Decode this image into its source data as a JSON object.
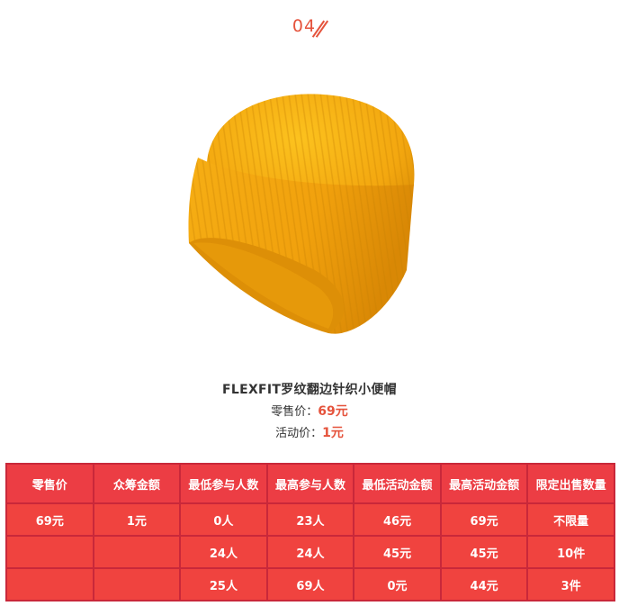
{
  "section_index": "04",
  "product": {
    "image_icon": "knit-beanie-yellow-image",
    "name": "FLEXFIT罗纹翻边针织小便帽",
    "retail_label": "零售价：",
    "retail_price": "69元",
    "activity_label": "活动价：",
    "activity_price": "1元"
  },
  "colors": {
    "accent": "#e5533c",
    "table_bg": "#f0433f",
    "table_border": "#c9283a",
    "beanie": "#f5a913"
  },
  "table": {
    "headers": [
      "零售价",
      "众筹金额",
      "最低参与人数",
      "最高参与人数",
      "最低活动金额",
      "最高活动金额",
      "限定出售数量"
    ],
    "rows": [
      [
        "69元",
        "1元",
        "0人",
        "23人",
        "46元",
        "69元",
        "不限量"
      ],
      [
        "",
        "",
        "24人",
        "24人",
        "45元",
        "45元",
        "10件"
      ],
      [
        "",
        "",
        "25人",
        "69人",
        "0元",
        "44元",
        "3件"
      ]
    ]
  }
}
